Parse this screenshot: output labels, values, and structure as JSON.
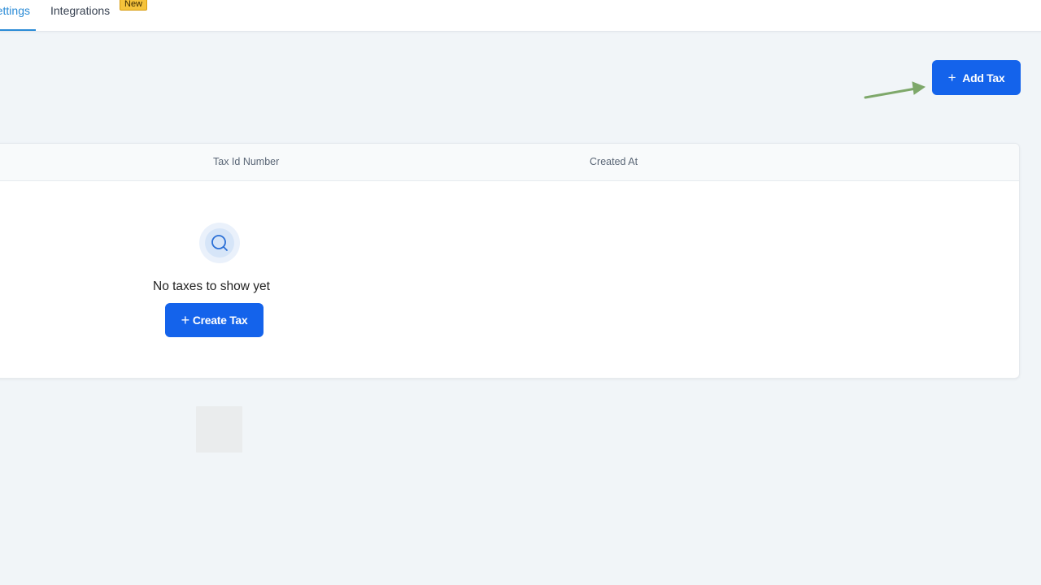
{
  "tabs": {
    "settings_label": "Settings",
    "integrations_label": "Integrations",
    "integrations_badge": "New"
  },
  "actions": {
    "add_tax_label": "Add Tax"
  },
  "table": {
    "columns": [
      "Tax Id Number",
      "Created At"
    ],
    "empty_message": "No taxes to show yet",
    "create_label": "Create Tax"
  },
  "icons": {
    "add": "plus-icon",
    "empty": "search-icon",
    "create": "plus-icon",
    "annotation": "arrow-icon"
  },
  "colors": {
    "primary": "#1463eb",
    "active_tab": "#2a8bd6",
    "badge": "#f5c33b",
    "annotation_arrow": "#7ea86a",
    "background": "#f1f5f8"
  }
}
